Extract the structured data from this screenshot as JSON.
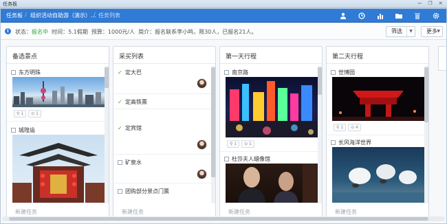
{
  "window": {
    "title": "任务板"
  },
  "nav": {
    "breadcrumb": [
      "任务板",
      "组织活动自助游（演示）...",
      "任务列表"
    ],
    "icons": [
      "user-icon",
      "clock-icon",
      "chart-icon",
      "folder-icon",
      "trash-icon",
      "gear-icon"
    ]
  },
  "info": {
    "status_label": "状态：",
    "status_value": "报名中",
    "time": "时间：5.1假期",
    "budget": "预算：1000元/人",
    "intro": "简介：报名联系李小鸣，限30人，已报名21人。",
    "filter_label": "筛选",
    "more_label": "更多"
  },
  "columns": [
    {
      "title": "备选景点",
      "new_task": "新建任务",
      "tasks": [
        {
          "label": "东方明珠",
          "done": false,
          "likes": "1",
          "comments": "1"
        },
        {
          "label": "城隍庙",
          "done": false
        }
      ]
    },
    {
      "title": "采买列表",
      "new_task": "新建任务",
      "tasks": [
        {
          "label": "定大巴",
          "done": true
        },
        {
          "label": "定高铁票",
          "done": true
        },
        {
          "label": "定宾馆",
          "done": true
        },
        {
          "label": "矿泉水",
          "done": false
        },
        {
          "label": "团购部分景点门票",
          "done": false
        }
      ]
    },
    {
      "title": "第一天行程",
      "new_task": "新建任务",
      "tasks": [
        {
          "label": "南京路",
          "done": false,
          "likes": "1",
          "comments": "1"
        },
        {
          "label": "杜莎夫人蜡像馆",
          "done": false
        }
      ]
    },
    {
      "title": "第二天行程",
      "new_task": "新建任务",
      "tasks": [
        {
          "label": "世博园",
          "done": false,
          "likes": "1",
          "comments": "4"
        },
        {
          "label": "长风海洋世界",
          "done": false
        }
      ]
    }
  ],
  "colors": {
    "nav_bg": "#2f7bd6",
    "status_green": "#3aa83a",
    "check_green": "#3aa83a"
  }
}
